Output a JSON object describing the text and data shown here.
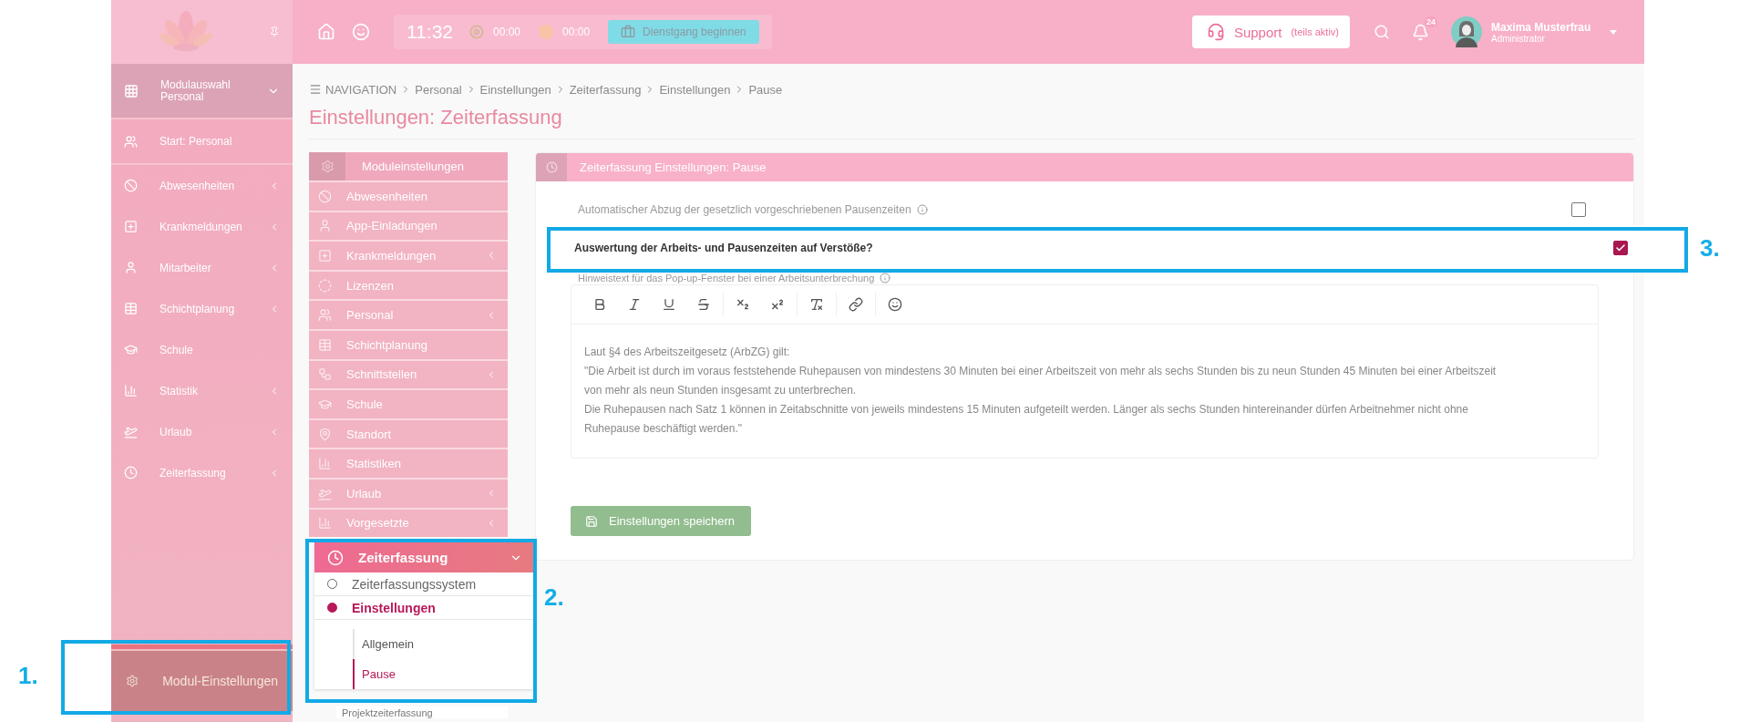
{
  "topbar": {
    "time": "11:32",
    "timers": [
      "00:00",
      "00:00"
    ],
    "duty_button": "Dienstgang beginnen",
    "support": {
      "label": "Support",
      "note": "(teils aktiv)"
    },
    "notifications": "24",
    "user": {
      "name": "Maxima Musterfrau",
      "role": "Administrator"
    }
  },
  "sidebar": {
    "module_switch": {
      "title": "Modulauswahl",
      "subtitle": "Personal"
    },
    "start": "Start: Personal",
    "items": [
      {
        "label": "Abwesenheiten",
        "has_submenu": true
      },
      {
        "label": "Krankmeldungen",
        "has_submenu": true
      },
      {
        "label": "Mitarbeiter",
        "has_submenu": true
      },
      {
        "label": "Schichtplanung",
        "has_submenu": true
      },
      {
        "label": "Schule",
        "has_submenu": false
      },
      {
        "label": "Statistik",
        "has_submenu": true
      },
      {
        "label": "Urlaub",
        "has_submenu": true
      },
      {
        "label": "Zeiterfassung",
        "has_submenu": true
      }
    ],
    "footer": "Modul-Einstellungen"
  },
  "breadcrumb": [
    "NAVIGATION",
    "Personal",
    "Einstellungen",
    "Zeiterfassung",
    "Einstellungen",
    "Pause"
  ],
  "page_title": "Einstellungen: Zeiterfassung",
  "settings_menu": {
    "title": "Moduleinstellungen",
    "items": [
      {
        "label": "Abwesenheiten",
        "has_submenu": false
      },
      {
        "label": "App-Einladungen",
        "has_submenu": false
      },
      {
        "label": "Krankmeldungen",
        "has_submenu": true
      },
      {
        "label": "Lizenzen",
        "has_submenu": false
      },
      {
        "label": "Personal",
        "has_submenu": true
      },
      {
        "label": "Schichtplanung",
        "has_submenu": false
      },
      {
        "label": "Schnittstellen",
        "has_submenu": true
      },
      {
        "label": "Schule",
        "has_submenu": false
      },
      {
        "label": "Standort",
        "has_submenu": false
      },
      {
        "label": "Statistiken",
        "has_submenu": false
      },
      {
        "label": "Urlaub",
        "has_submenu": true
      },
      {
        "label": "Vorgesetzte",
        "has_submenu": true
      }
    ],
    "open_section": {
      "label": "Zeiterfassung",
      "expanded": true,
      "children": [
        {
          "label": "Zeiterfassungssystem",
          "selected": false
        },
        {
          "label": "Einstellungen",
          "selected": true,
          "children": [
            {
              "label": "Allgemein",
              "selected": false
            },
            {
              "label": "Pause",
              "selected": true
            }
          ]
        }
      ]
    },
    "next_item": "Projektzeiterfassung"
  },
  "panel": {
    "title": "Zeiterfassung Einstellungen: Pause",
    "options": [
      {
        "label": "Automatischer Abzug der gesetzlich vorgeschriebenen Pausenzeiten",
        "info": true,
        "checked": false,
        "emphasized": false
      },
      {
        "label": "Auswertung der Arbeits- und Pausenzeiten auf Verstöße?",
        "info": false,
        "checked": true,
        "emphasized": true
      }
    ],
    "editor": {
      "label": "Hinweistext für das Pop-up-Fenster bei einer Arbeitsunterbrechung",
      "paragraphs": [
        "Laut §4 des Arbeitszeitgesetz (ArbZG) gilt:",
        "\"Die Arbeit ist durch im voraus feststehende Ruhepausen von mindestens 30 Minuten bei einer Arbeitszeit von mehr als sechs Stunden bis zu neun Stunden 45 Minuten bei einer Arbeitszeit von mehr als neun Stunden insgesamt zu unterbrechen.",
        "Die Ruhepausen nach Satz 1 können in Zeitabschnitte von jeweils mindestens 15 Minuten aufgeteilt werden. Länger als sechs Stunden hintereinander dürfen Arbeitnehmer nicht ohne Ruhepause beschäftigt werden.\""
      ]
    },
    "save_button": "Einstellungen speichern"
  },
  "annotations": [
    {
      "label": "1."
    },
    {
      "label": "2."
    },
    {
      "label": "3."
    }
  ]
}
